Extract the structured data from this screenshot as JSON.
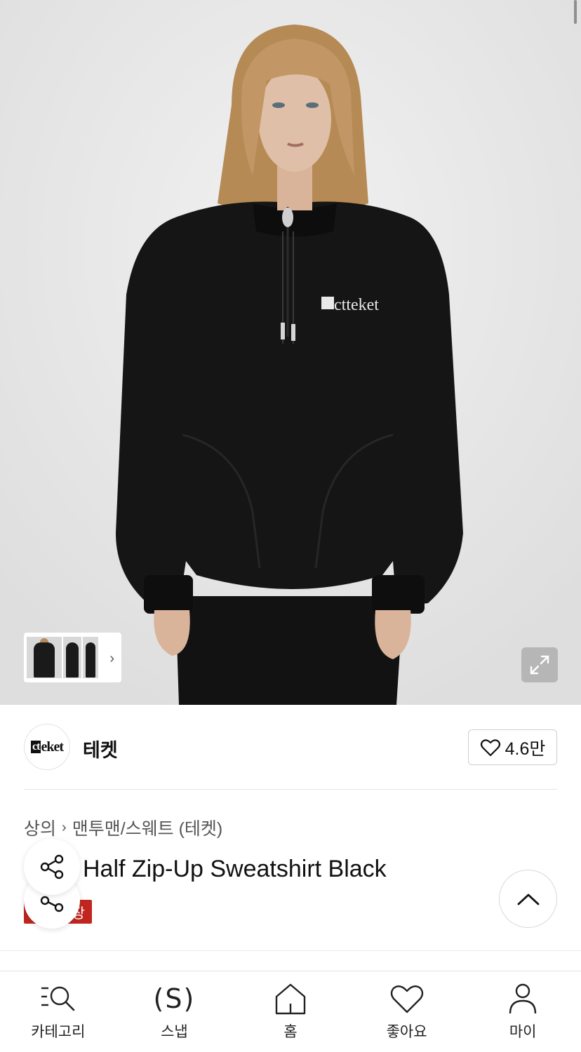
{
  "hero": {
    "shirt_logo": "ctteket",
    "expand_icon": "expand-icon"
  },
  "brand": {
    "logo_text": "ctteket",
    "name": "테켓",
    "like_count": "4.6만"
  },
  "breadcrumb": {
    "category": "상의",
    "subcategory": "맨투맨/스웨트 (테켓)"
  },
  "product": {
    "title": "Half Zip-Up Sweatshirt Black",
    "badge": "장"
  },
  "nav": {
    "items": [
      {
        "label": "카테고리",
        "icon": "category-search-icon"
      },
      {
        "label": "스냅",
        "icon": "snap-icon"
      },
      {
        "label": "홈",
        "icon": "home-icon"
      },
      {
        "label": "좋아요",
        "icon": "heart-icon"
      },
      {
        "label": "마이",
        "icon": "person-icon"
      }
    ]
  },
  "colors": {
    "badge": "#c0261f",
    "text": "#111111",
    "muted": "#555555"
  }
}
